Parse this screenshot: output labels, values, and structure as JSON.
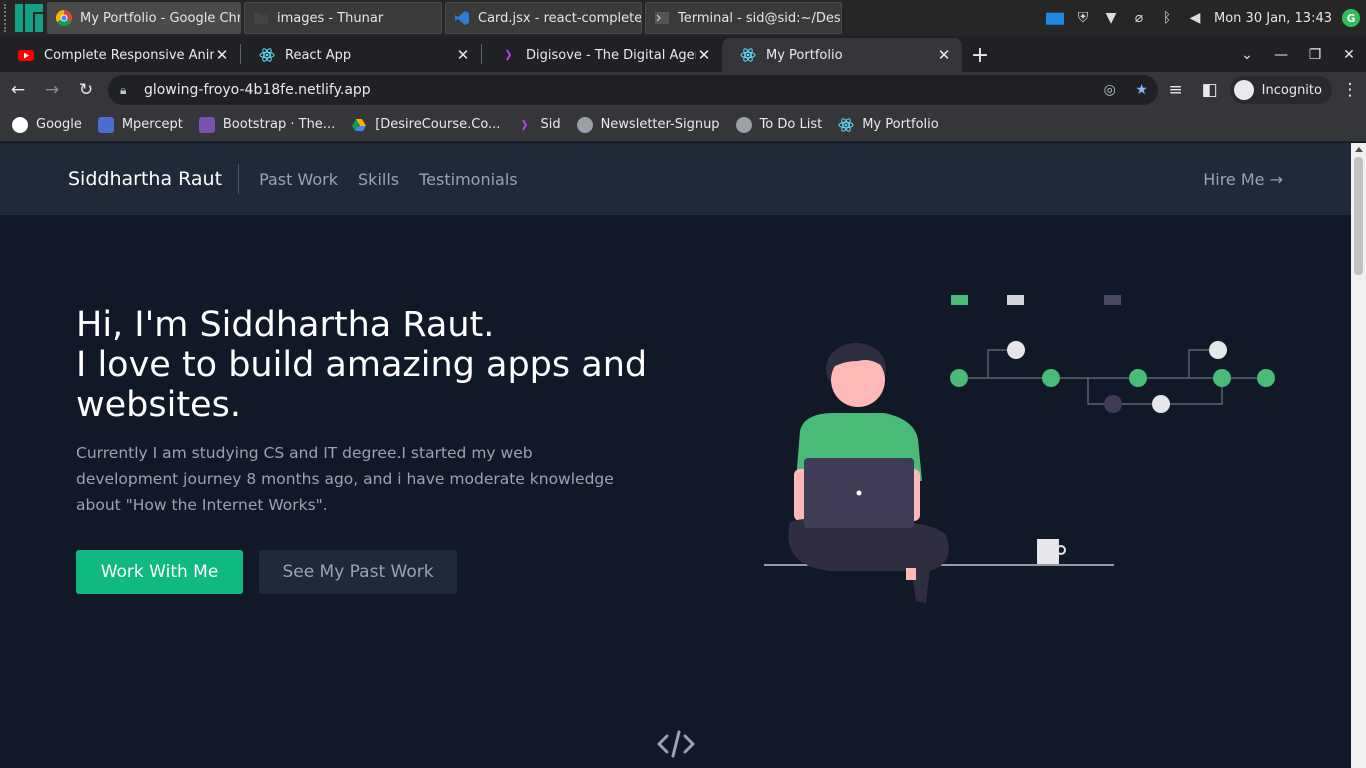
{
  "taskbar": {
    "tasks": [
      {
        "label": "My Portfolio - Google Chr..."
      },
      {
        "label": "images - Thunar"
      },
      {
        "label": "Card.jsx - react-complete-..."
      },
      {
        "label": "Terminal - sid@sid:~/Desk..."
      }
    ],
    "clock": "Mon 30 Jan, 13:43"
  },
  "tabs": [
    {
      "label": " Complete Responsive Anim"
    },
    {
      "label": "React App"
    },
    {
      "label": "Digisove - The Digital Agency"
    },
    {
      "label": "My Portfolio"
    }
  ],
  "toolbar": {
    "url": "glowing-froyo-4b18fe.netlify.app",
    "incognito_label": "Incognito"
  },
  "bookmarks": [
    {
      "label": "Google",
      "color": "#ffffff"
    },
    {
      "label": "Mpercept",
      "color": "#4a6fd1"
    },
    {
      "label": "Bootstrap · The...",
      "color": "#7952b3"
    },
    {
      "label": "[DesireCourse.Co...",
      "color": "#1fa463"
    },
    {
      "label": "Sid",
      "color": "#a020f0"
    },
    {
      "label": "Newsletter-Signup",
      "color": "#9aa0a6"
    },
    {
      "label": "To Do List",
      "color": "#9aa0a6"
    },
    {
      "label": "My Portfolio",
      "color": "#61dafb"
    }
  ],
  "site": {
    "brand": "Siddhartha Raut",
    "nav": [
      "Past Work",
      "Skills",
      "Testimonials"
    ],
    "hire": "Hire Me →",
    "hero_line1": "Hi, I'm Siddhartha Raut.",
    "hero_line2": "I love to build amazing apps and websites.",
    "hero_paragraph": "Currently I am studying CS and IT degree.I started my web development journey 8 months ago, and i have moderate knowledge about \"How the Internet Works\".",
    "primary_button": "Work With Me",
    "secondary_button": "See My Past Work"
  },
  "colors": {
    "accent": "#10b981",
    "page_bg": "#111827",
    "nav_bg": "#1f2937"
  }
}
